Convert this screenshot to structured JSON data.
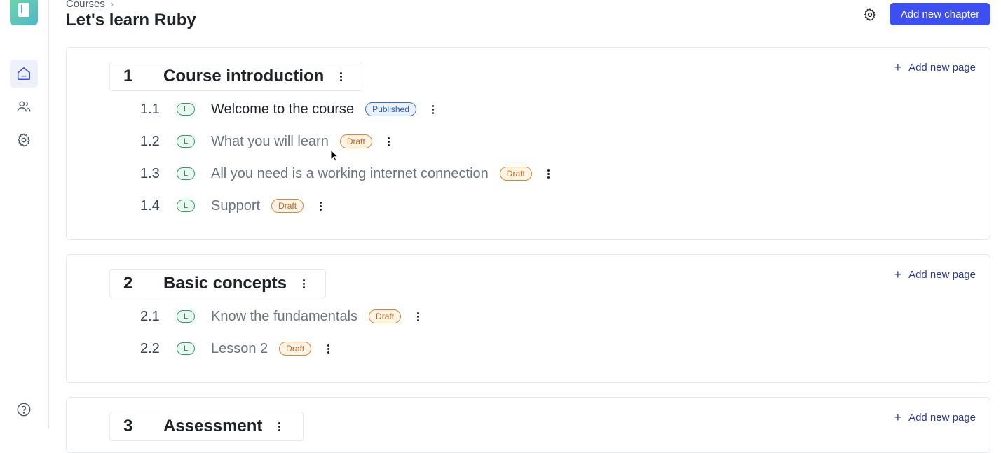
{
  "breadcrumb": {
    "root": "Courses"
  },
  "page": {
    "title": "Let's learn Ruby"
  },
  "toolbar": {
    "add_chapter": "Add new chapter"
  },
  "chapters": [
    {
      "number": "1",
      "name": "Course introduction",
      "add_page": "Add new page",
      "lessons": [
        {
          "number": "1.1",
          "badge": "L",
          "name": "Welcome to the course",
          "status": "Published"
        },
        {
          "number": "1.2",
          "badge": "L",
          "name": "What you will learn",
          "status": "Draft"
        },
        {
          "number": "1.3",
          "badge": "L",
          "name": "All you need is a working internet connection",
          "status": "Draft"
        },
        {
          "number": "1.4",
          "badge": "L",
          "name": "Support",
          "status": "Draft"
        }
      ]
    },
    {
      "number": "2",
      "name": "Basic concepts",
      "add_page": "Add new page",
      "lessons": [
        {
          "number": "2.1",
          "badge": "L",
          "name": "Know the fundamentals",
          "status": "Draft"
        },
        {
          "number": "2.2",
          "badge": "L",
          "name": "Lesson 2",
          "status": "Draft"
        }
      ]
    },
    {
      "number": "3",
      "name": "Assessment",
      "add_page": "Add new page",
      "lessons": []
    }
  ],
  "colors": {
    "accent": "#3d4ff0",
    "published": "#3b6fd8",
    "draft": "#d98a2b",
    "lesson_badge": "#2f9e6e"
  },
  "icons": {
    "logo": "book-icon",
    "home": "home-icon",
    "users": "users-icon",
    "settings": "gear-icon",
    "help": "help-icon",
    "more": "kebab-icon",
    "add": "plus-icon"
  }
}
